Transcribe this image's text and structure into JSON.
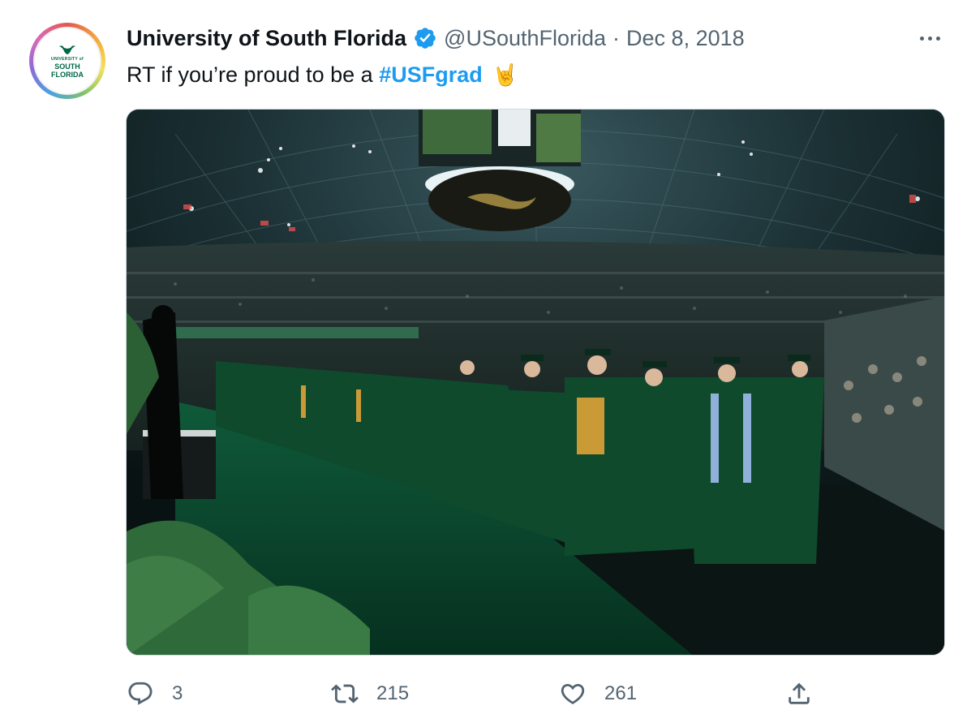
{
  "tweet": {
    "author": {
      "name": "University of South Florida",
      "handle": "@USouthFlorida",
      "verified": true,
      "avatar_text": {
        "small": "UNIVERSITY of",
        "line1": "SOUTH",
        "line2": "FLORIDA"
      }
    },
    "separator": "·",
    "date": "Dec 8, 2018",
    "text": {
      "prefix": "RT if you’re proud to be a ",
      "hashtag": "#USFgrad",
      "emoji": "🤘"
    },
    "media": {
      "type": "photo",
      "description_icon": "graduation-ceremony-photo"
    },
    "actions": {
      "reply_count": "3",
      "retweet_count": "215",
      "like_count": "261"
    }
  },
  "colors": {
    "accent": "#1d9bf0",
    "muted": "#536471",
    "text": "#0f1419",
    "usf_green": "#006747"
  }
}
